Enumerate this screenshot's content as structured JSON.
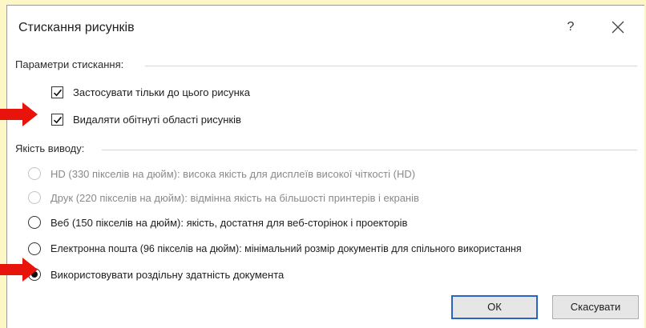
{
  "dialog": {
    "title": "Стискання рисунків",
    "help_label": "?"
  },
  "compression": {
    "group_label": "Параметри стискання:",
    "options": [
      {
        "label": "Застосувати тільки до цього рисунка",
        "checked": true
      },
      {
        "label": "Видаляти обітнуті області рисунків",
        "checked": true
      }
    ]
  },
  "output": {
    "group_label": "Якість виводу:",
    "options": [
      {
        "label": "HD (330 пікселів на дюйм): висока якість для дисплеїв високої чіткості (HD)",
        "selected": false,
        "enabled": false
      },
      {
        "label": "Друк (220 пікселів на дюйм): відмінна якість на більшості принтерів і екранів",
        "selected": false,
        "enabled": false
      },
      {
        "label": "Веб (150 пікселів на дюйм): якість, достатня для веб-сторінок і проекторів",
        "selected": false,
        "enabled": true
      },
      {
        "label": "Електронна пошта (96 пікселів на дюйм): мінімальний розмір документів для спільного використання",
        "selected": false,
        "enabled": true
      },
      {
        "label": "Використовувати роздільну здатність документа",
        "selected": true,
        "enabled": true
      }
    ]
  },
  "buttons": {
    "ok_label": "ОК",
    "cancel_label": "Скасувати"
  },
  "colors": {
    "page_background": "#fdf7c6",
    "arrow": "#e8140c",
    "default_button_border": "#2a64c4"
  },
  "icons": {
    "close": "close-icon",
    "checkmark": "checkmark-icon",
    "annotation_arrow": "red-arrow-icon"
  }
}
